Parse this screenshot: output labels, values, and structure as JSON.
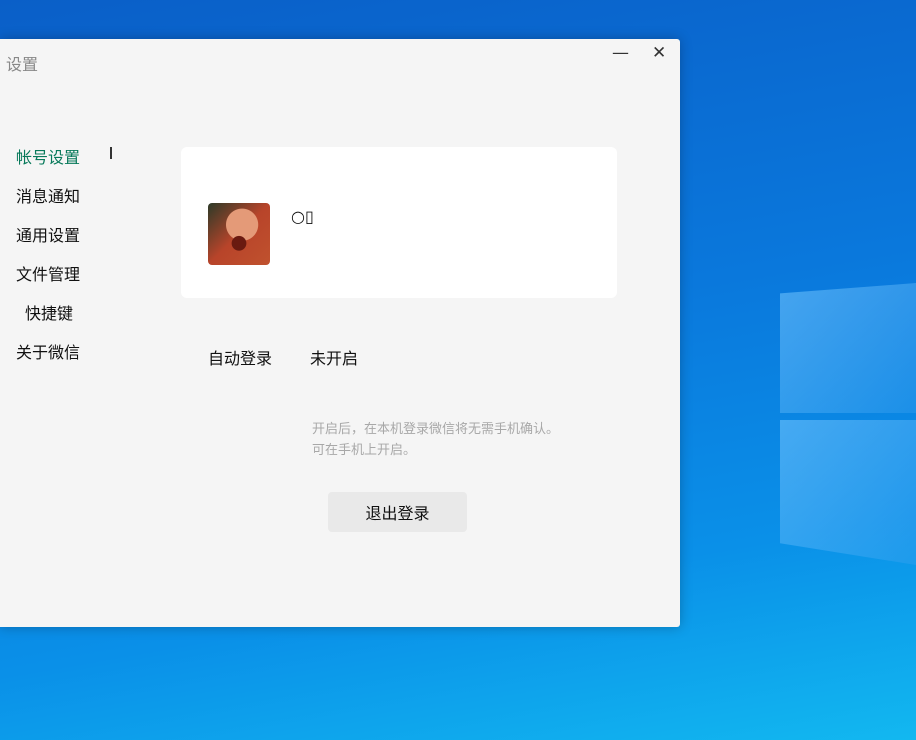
{
  "window": {
    "title": "设置",
    "minimize_icon": "minimize-icon",
    "close_icon": "close-icon"
  },
  "sidebar": {
    "items": [
      {
        "label": "帐号设置",
        "active": true
      },
      {
        "label": "消息通知"
      },
      {
        "label": "通用设置"
      },
      {
        "label": "文件管理"
      },
      {
        "label": "快捷键"
      },
      {
        "label": "关于微信"
      }
    ]
  },
  "account": {
    "username": "○▯"
  },
  "auto_login": {
    "label": "自动登录",
    "value": "未开启",
    "hint_line1": "开启后，在本机登录微信将无需手机确认。",
    "hint_line2": "可在手机上开启。"
  },
  "logout_label": "退出登录",
  "colors": {
    "accent": "#07795a",
    "window_bg": "#f5f5f5"
  }
}
